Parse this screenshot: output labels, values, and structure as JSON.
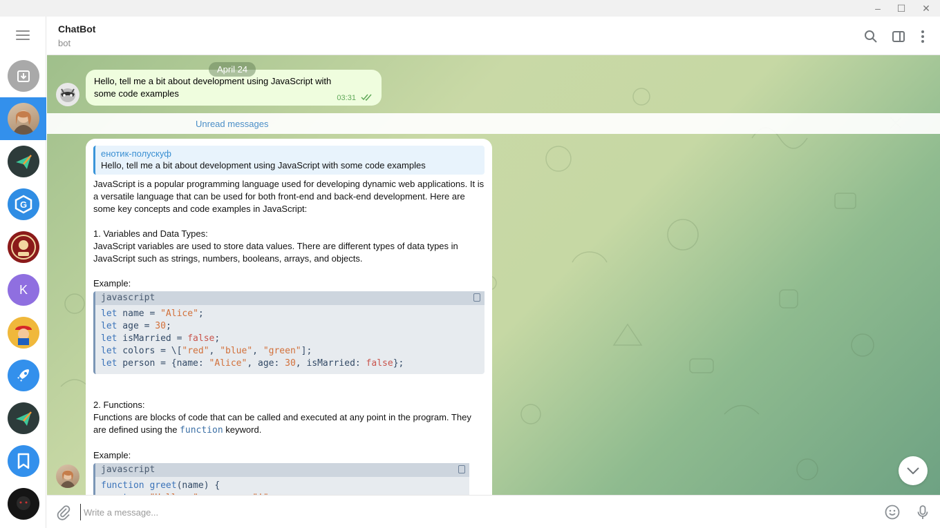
{
  "window": {
    "minimize_glyph": "–",
    "maximize_glyph": "☐",
    "close_glyph": "✕"
  },
  "sidebar": {
    "items": [
      {
        "name": "archive",
        "icon": "archive-icon",
        "color": "#a8a8a8"
      },
      {
        "name": "chat-selected",
        "icon": "avatar-photo",
        "color": "#c9a184",
        "active": true
      },
      {
        "name": "chat-green-plane",
        "icon": "paper-plane-logo",
        "color": "#2d3b3a"
      },
      {
        "name": "chat-g",
        "icon": "g-logo",
        "color": "#2f8de4"
      },
      {
        "name": "chat-badge",
        "icon": "badge-logo",
        "color": "#8b1a1a"
      },
      {
        "name": "chat-k",
        "letter": "K",
        "color": "#8f6fe0"
      },
      {
        "name": "chat-mario",
        "icon": "mario-avatar",
        "color": "#f0b83b"
      },
      {
        "name": "chat-rocket",
        "icon": "rocket-icon",
        "color": "#3390ec"
      },
      {
        "name": "chat-green-plane-2",
        "icon": "paper-plane-logo",
        "color": "#2d3b3a"
      },
      {
        "name": "saved-messages",
        "icon": "bookmark-icon",
        "color": "#3390ec"
      },
      {
        "name": "chat-dark",
        "icon": "dark-avatar",
        "color": "#1a1a1a"
      }
    ]
  },
  "header": {
    "title": "ChatBot",
    "status": "bot"
  },
  "chat": {
    "date_pill": "April 24",
    "outgoing": {
      "text": "Hello, tell me a bit about development using JavaScript with some code examples",
      "time": "03:31"
    },
    "unread_label": "Unread messages",
    "incoming": {
      "reply_author": "енотик-полускуф",
      "reply_text": "Hello, tell me a bit about development using JavaScript with some code examples",
      "intro": "JavaScript is a popular programming language used for developing dynamic web applications. It is a versatile language that can be used for both front-end and back-end development. Here are some key concepts and code examples in JavaScript:",
      "section1_title": "1. Variables and Data Types:",
      "section1_text": "JavaScript variables are used to store data values. There are different types of data types in JavaScript such as strings, numbers, booleans, arrays, and objects.",
      "example_label_1": "Example:",
      "code1_lang": "javascript",
      "section2_title": "2. Functions:",
      "section2_text_a": "Functions are blocks of code that can be called and executed at any point in the program. They are defined using the ",
      "section2_inline_code": "function",
      "section2_text_b": " keyword.",
      "example_label_2": "Example:",
      "code2_lang": "javascript"
    }
  },
  "composer": {
    "placeholder": "Write a message..."
  },
  "colors": {
    "accent": "#3390ec",
    "outgoing_bubble": "#effdde",
    "check_green": "#5fa858"
  }
}
